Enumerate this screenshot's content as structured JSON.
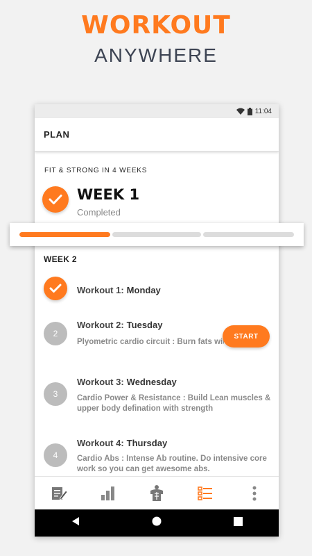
{
  "promo": {
    "title": "WORKOUT",
    "subtitle": "ANYWHERE"
  },
  "statusbar": {
    "time": "11:04",
    "icons": [
      "wifi-icon",
      "battery-icon"
    ]
  },
  "appbar": {
    "title": "PLAN"
  },
  "plan": {
    "heading": "FIT & STRONG IN 4 WEEKS",
    "current_week": {
      "title": "WEEK 1",
      "status": "Completed"
    }
  },
  "progress": {
    "segments": [
      1.0,
      0.0,
      0.0
    ],
    "accent": "#ff7a1f"
  },
  "week2": {
    "heading": "WEEK 2",
    "workouts": [
      {
        "number": "1",
        "title": "Workout 1",
        "day": "Monday",
        "done": true,
        "description": ""
      },
      {
        "number": "2",
        "title": "Workout 2",
        "day": "Tuesday",
        "done": false,
        "description": "Plyometric cardio circuit :  Burn fats with intervals of intense lower-body ...",
        "action": "START"
      },
      {
        "number": "3",
        "title": "Workout 3",
        "day": "Wednesday",
        "done": false,
        "description": "Cardio Power & Resistance :  Build Lean muscles & upper body defination with strength"
      },
      {
        "number": "4",
        "title": "Workout 4",
        "day": "Thursday",
        "done": false,
        "description": "Cardio Abs :  Intense Ab routine. Do intensive core work so you can get awesome abs."
      }
    ]
  },
  "bottom_nav": {
    "items": [
      {
        "name": "notes-icon",
        "active": false
      },
      {
        "name": "stats-icon",
        "active": false
      },
      {
        "name": "body-icon",
        "active": false
      },
      {
        "name": "plan-list-icon",
        "active": true
      },
      {
        "name": "more-icon",
        "active": false
      }
    ]
  },
  "colors": {
    "accent": "#ff7a1f",
    "text_dark": "#222222",
    "muted": "#8a8a8a"
  }
}
